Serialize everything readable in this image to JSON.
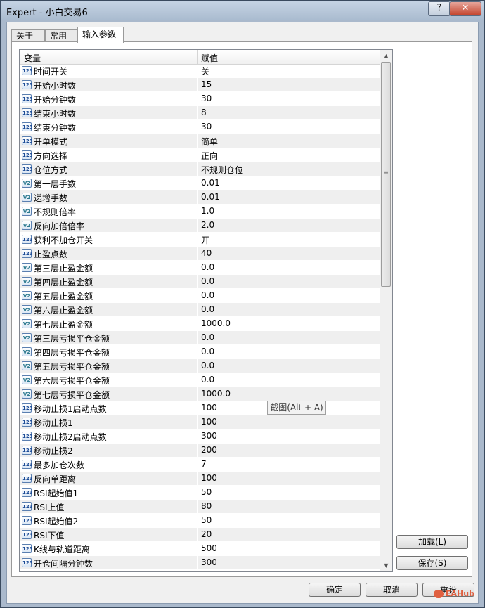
{
  "window": {
    "title": "Expert - 小白交易6"
  },
  "tabs": [
    {
      "label": "关于"
    },
    {
      "label": "常用"
    },
    {
      "label": "输入参数"
    }
  ],
  "grid": {
    "col_variable": "变量",
    "col_value": "赋值",
    "rows": [
      {
        "icon": "123",
        "name": "时间开关",
        "value": "关"
      },
      {
        "icon": "123",
        "name": "开始小时数",
        "value": "15"
      },
      {
        "icon": "123",
        "name": "开始分钟数",
        "value": "30"
      },
      {
        "icon": "123",
        "name": "结束小时数",
        "value": "8"
      },
      {
        "icon": "123",
        "name": "结束分钟数",
        "value": "30"
      },
      {
        "icon": "123",
        "name": "开单模式",
        "value": "简单"
      },
      {
        "icon": "123",
        "name": "方向选择",
        "value": "正向"
      },
      {
        "icon": "123",
        "name": "仓位方式",
        "value": "不规则仓位"
      },
      {
        "icon": "V2",
        "name": "第一层手数",
        "value": "0.01"
      },
      {
        "icon": "V2",
        "name": "递增手数",
        "value": "0.01"
      },
      {
        "icon": "V2",
        "name": "不规则倍率",
        "value": "1.0"
      },
      {
        "icon": "V2",
        "name": "反向加倍倍率",
        "value": "2.0"
      },
      {
        "icon": "123",
        "name": "获利不加仓开关",
        "value": "开"
      },
      {
        "icon": "123",
        "name": "止盈点数",
        "value": "40"
      },
      {
        "icon": "V2",
        "name": "第三层止盈金额",
        "value": "0.0"
      },
      {
        "icon": "V2",
        "name": "第四层止盈金额",
        "value": "0.0"
      },
      {
        "icon": "V2",
        "name": "第五层止盈金额",
        "value": "0.0"
      },
      {
        "icon": "V2",
        "name": "第六层止盈金额",
        "value": "0.0"
      },
      {
        "icon": "V2",
        "name": "第七层止盈金额",
        "value": "1000.0"
      },
      {
        "icon": "V2",
        "name": "第三层亏损平仓金额",
        "value": "0.0"
      },
      {
        "icon": "V2",
        "name": "第四层亏损平仓金额",
        "value": "0.0"
      },
      {
        "icon": "V2",
        "name": "第五层亏损平仓金额",
        "value": "0.0"
      },
      {
        "icon": "V2",
        "name": "第六层亏损平仓金额",
        "value": "0.0"
      },
      {
        "icon": "V2",
        "name": "第七层亏损平仓金额",
        "value": "1000.0"
      },
      {
        "icon": "123",
        "name": "移动止损1启动点数",
        "value": "100"
      },
      {
        "icon": "123",
        "name": "移动止损1",
        "value": "100"
      },
      {
        "icon": "123",
        "name": "移动止损2启动点数",
        "value": "300"
      },
      {
        "icon": "123",
        "name": "移动止损2",
        "value": "200"
      },
      {
        "icon": "123",
        "name": "最多加仓次数",
        "value": "7"
      },
      {
        "icon": "123",
        "name": "反向单距离",
        "value": "100"
      },
      {
        "icon": "123",
        "name": "RSI起始值1",
        "value": "50"
      },
      {
        "icon": "123",
        "name": "RSI上值",
        "value": "80"
      },
      {
        "icon": "123",
        "name": "RSI起始值2",
        "value": "50"
      },
      {
        "icon": "123",
        "name": "RSI下值",
        "value": "20"
      },
      {
        "icon": "123",
        "name": "K线与轨道距离",
        "value": "500"
      },
      {
        "icon": "123",
        "name": "开仓间隔分钟数",
        "value": "300"
      }
    ]
  },
  "side_buttons": {
    "load": "加载(L)",
    "save": "保存(S)"
  },
  "bottom_buttons": {
    "ok": "确定",
    "cancel": "取消",
    "reset": "重设"
  },
  "tooltip": "截图(Alt + A)",
  "watermark": "EAHub",
  "title_buttons": {
    "help": "?",
    "close": "✕"
  }
}
